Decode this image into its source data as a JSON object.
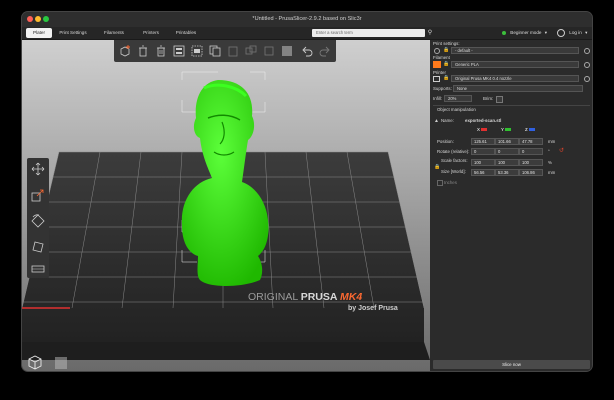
{
  "window": {
    "title": "*Untitled - PrusaSlicer-2.9.2 based on Slic3r"
  },
  "tabs": [
    {
      "label": "Plater"
    },
    {
      "label": "Print Settings"
    },
    {
      "label": "Filaments"
    },
    {
      "label": "Printers"
    },
    {
      "label": "Printables"
    }
  ],
  "search": {
    "placeholder": "Enter a search term"
  },
  "mode": {
    "label": "Beginner mode",
    "color": "#3cbf3c"
  },
  "login": {
    "label": "Log in"
  },
  "bed": {
    "brand_line1_a": "ORIGINAL ",
    "brand_line1_b": "PRUSA ",
    "brand_line1_c": "MK4",
    "brand_line2": "by Josef Prusa",
    "accent": "#fa6831"
  },
  "model": {
    "color": "#22e000"
  },
  "sidebar": {
    "print_settings_label": "Print settings:",
    "print_settings_value": "- default -",
    "filament_label": "Filament",
    "filament_value": "Generic PLA",
    "filament_color": "#ff7a1c",
    "printer_label": "Printer",
    "printer_value": "Original Prusa MK4 0.4 nozzle",
    "supports_label": "Supports:",
    "supports_value": "None",
    "infill_label": "Infill:",
    "infill_value": "20%",
    "brim_label": "Brim:",
    "object_manipulation_label": "Object manipulation",
    "name_label": "Name:",
    "name_value": "exported-scan.stl",
    "axis_x": "X",
    "axis_y": "Y",
    "axis_z": "Z",
    "position_label": "Position:",
    "position": [
      "125.61",
      "101.66",
      "47.78"
    ],
    "position_unit": "mm",
    "rotate_label": "Rotate (relative):",
    "rotate": [
      "0",
      "0",
      "0"
    ],
    "rotate_unit": "°",
    "scale_label": "Scale factors:",
    "scale": [
      "100",
      "100",
      "100"
    ],
    "scale_unit": "%",
    "size_label": "Size [World]:",
    "size": [
      "56.56",
      "53.36",
      "106.86"
    ],
    "size_unit": "mm",
    "inches_label": "Inches",
    "slice_label": "Slice now"
  }
}
